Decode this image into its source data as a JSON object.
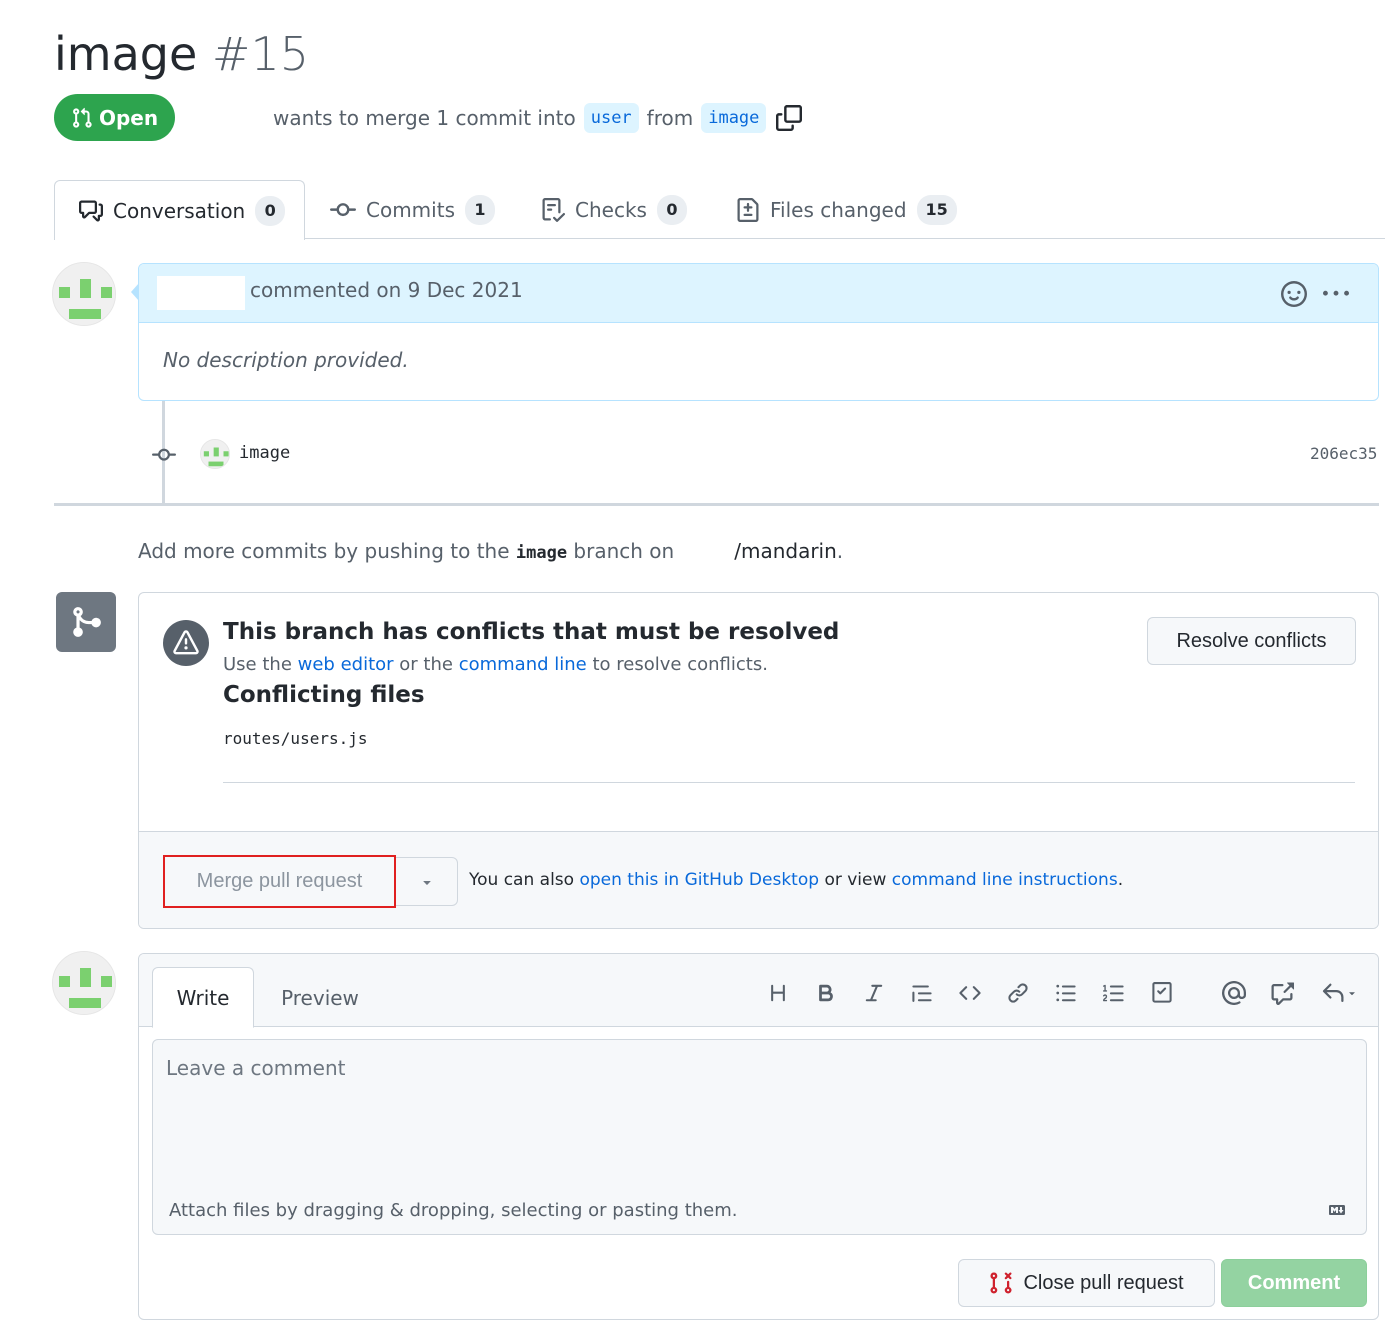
{
  "header": {
    "title": "image",
    "number": "#15",
    "state": "Open",
    "merge_text": "wants to merge 1 commit into",
    "base_branch": "user",
    "from_text": "from",
    "head_branch": "image"
  },
  "tabs": [
    {
      "label": "Conversation",
      "count": "0"
    },
    {
      "label": "Commits",
      "count": "1"
    },
    {
      "label": "Checks",
      "count": "0"
    },
    {
      "label": "Files changed",
      "count": "15"
    }
  ],
  "comment": {
    "meta": "commented on 9 Dec 2021",
    "body": "No description provided."
  },
  "commit": {
    "message": "image",
    "sha": "206ec35"
  },
  "push_hint": {
    "prefix": "Add more commits by pushing to the",
    "branch": "image",
    "middle": "branch on",
    "repo": "/mandarin",
    "suffix": "."
  },
  "merge_box": {
    "conflict_title": "This branch has conflicts that must be resolved",
    "sub_prefix": "Use the",
    "web_editor": "web editor",
    "sub_or": "or the",
    "command_line": "command line",
    "sub_suffix": "to resolve conflicts.",
    "files_title": "Conflicting files",
    "files": [
      "routes/users.js"
    ],
    "resolve_button": "Resolve conflicts",
    "merge_button": "Merge pull request",
    "alt_prefix": "You can also",
    "alt_desktop": "open this in GitHub Desktop",
    "alt_middle": "or view",
    "alt_cli": "command line instructions",
    "alt_suffix": "."
  },
  "form": {
    "write_tab": "Write",
    "preview_tab": "Preview",
    "placeholder": "Leave a comment",
    "attach_text": "Attach files by dragging & dropping, selecting or pasting them.",
    "close_button": "Close pull request",
    "comment_button": "Comment"
  },
  "colors": {
    "open_green": "#2da44e",
    "link_blue": "#0969da",
    "highlight_red": "#e0201f"
  }
}
